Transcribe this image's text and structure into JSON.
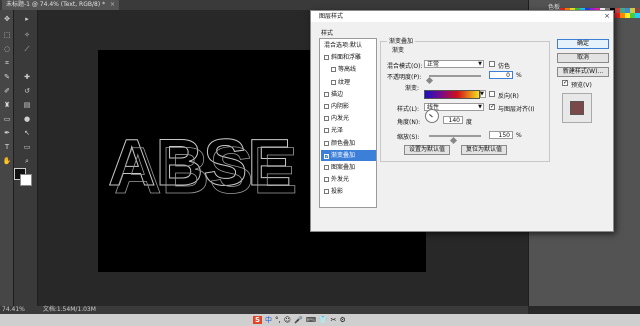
{
  "document": {
    "tab_title": "未标题-1 @ 74.4% (Text, RGB/8) *",
    "close_glyph": "×",
    "status_zoom": "74.41%",
    "status_doc": "文档:1.54M/1.03M"
  },
  "canvas": {
    "text": "ABSE"
  },
  "panels": {
    "color_tab": "色板"
  },
  "dialog": {
    "title": "图层样式",
    "close_glyph": "×",
    "styles_header": "样式",
    "style_list": [
      {
        "label": "混合选项:默认",
        "checkbox": false,
        "checked": false,
        "selected": false
      },
      {
        "label": "斜面和浮雕",
        "checkbox": true,
        "checked": false,
        "selected": false
      },
      {
        "label": "等高线",
        "checkbox": true,
        "checked": false,
        "selected": false,
        "indent": true
      },
      {
        "label": "纹理",
        "checkbox": true,
        "checked": false,
        "selected": false,
        "indent": true
      },
      {
        "label": "描边",
        "checkbox": true,
        "checked": false,
        "selected": false
      },
      {
        "label": "内阴影",
        "checkbox": true,
        "checked": false,
        "selected": false
      },
      {
        "label": "内发光",
        "checkbox": true,
        "checked": false,
        "selected": false
      },
      {
        "label": "光泽",
        "checkbox": true,
        "checked": false,
        "selected": false
      },
      {
        "label": "颜色叠加",
        "checkbox": true,
        "checked": false,
        "selected": false
      },
      {
        "label": "渐变叠加",
        "checkbox": true,
        "checked": true,
        "selected": true
      },
      {
        "label": "图案叠加",
        "checkbox": true,
        "checked": false,
        "selected": false
      },
      {
        "label": "外发光",
        "checkbox": true,
        "checked": false,
        "selected": false
      },
      {
        "label": "投影",
        "checkbox": true,
        "checked": false,
        "selected": false
      }
    ],
    "group_title": "渐变叠加",
    "sub_title": "渐变",
    "blend_mode_label": "混合模式(O):",
    "blend_mode_value": "正常",
    "dither_label": "仿色",
    "opacity_label": "不透明度(P):",
    "opacity_value": "0",
    "percent": "%",
    "gradient_label": "渐变:",
    "reverse_label": "反向(R)",
    "style_label": "样式(L):",
    "style_value": "线性",
    "align_label": "与图层对齐(I)",
    "angle_label": "角度(N):",
    "angle_value": "140",
    "degree": "度",
    "scale_label": "缩放(S):",
    "scale_value": "150",
    "set_default_btn": "设置为默认值",
    "reset_default_btn": "复位为默认值",
    "ok_btn": "确定",
    "cancel_btn": "取消",
    "new_style_btn": "新建样式(W)...",
    "preview_label": "预览(V)",
    "preview_checked": true
  },
  "ime": {
    "items": [
      "S",
      "中",
      "°,",
      "☺",
      "🎤",
      "⌨",
      "👕",
      "✂",
      "⚙"
    ]
  }
}
